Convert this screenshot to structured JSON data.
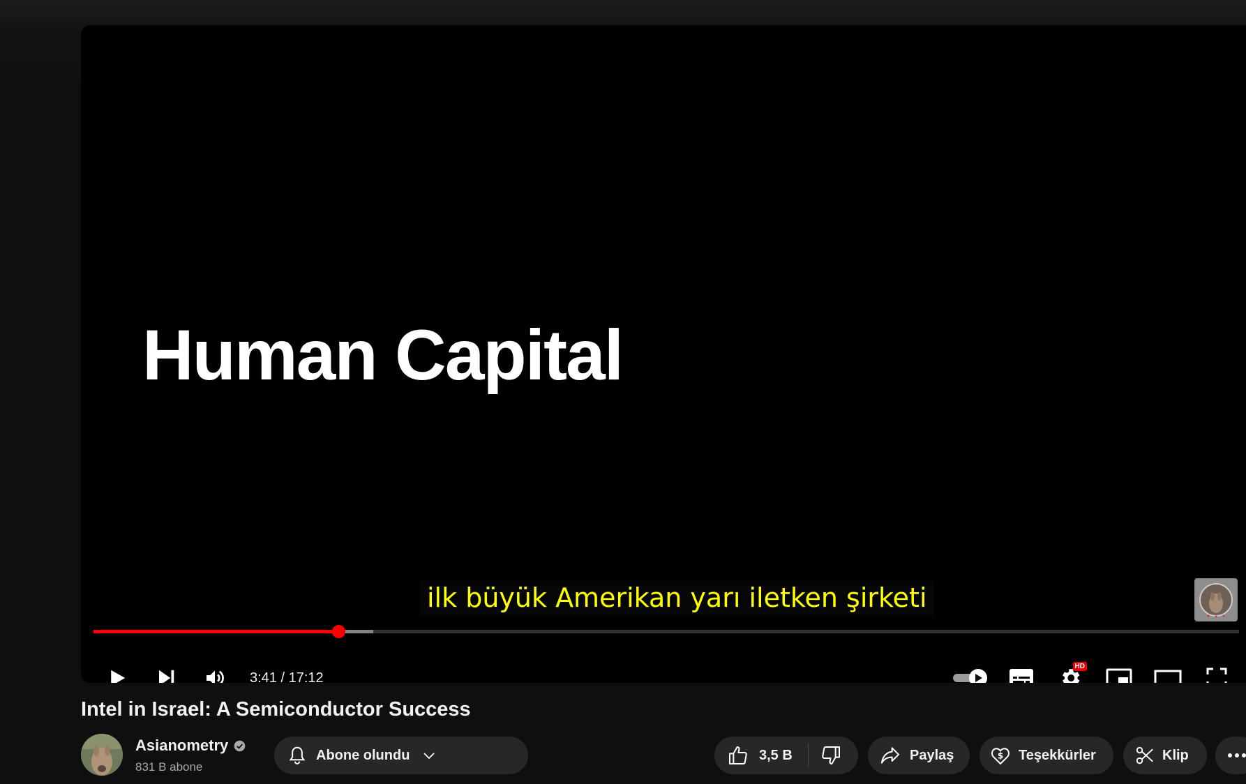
{
  "player": {
    "title_card_text": "Human Capital",
    "caption": "ilk büyük Amerikan yarı iletken şirketi",
    "progress": {
      "played_fraction": 0.2139,
      "buffered_fraction": 0.2441
    },
    "time_current": "3:41",
    "time_separator": " / ",
    "time_total": "17:12",
    "hd_badge": "HD",
    "controls": {
      "play": "play-icon",
      "next": "next-icon",
      "volume": "volume-icon",
      "autoplay": "autoplay-toggle-icon",
      "subtitles": "subtitles-icon",
      "settings": "gear-icon",
      "miniplayer": "miniplayer-icon",
      "theater": "theater-mode-icon",
      "fullscreen": "fullscreen-icon"
    }
  },
  "video": {
    "title": "Intel in Israel: A Semiconductor Success"
  },
  "channel": {
    "name": "Asianometry",
    "subscribers": "831 B abone"
  },
  "actions": {
    "subscribe_label": "Abone olundu",
    "like_count": "3,5 B",
    "share_label": "Paylaş",
    "thanks_label": "Teşekkürler",
    "clip_label": "Klip"
  },
  "colors": {
    "accent": "#ff0000",
    "caption_text": "#ffff00",
    "pill_bg": "#272727",
    "page_bg": "#0f0f0f"
  }
}
